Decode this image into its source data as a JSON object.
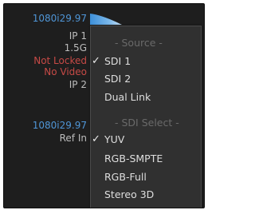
{
  "status_panel": {
    "format_top": "1080i29.97",
    "input_1": "IP 1",
    "bitrate": "1.5G",
    "lock_status": "Not Locked",
    "video_status": "No Video",
    "input_2": "IP 2",
    "format_bottom": "1080i29.97",
    "ref_label": "Ref In"
  },
  "dropdown": {
    "source_header": "- Source -",
    "source_options": [
      {
        "label": "SDI 1",
        "checked": true
      },
      {
        "label": "SDI 2",
        "checked": false
      },
      {
        "label": "Dual Link",
        "checked": false
      }
    ],
    "sdi_select_header": "- SDI Select -",
    "sdi_options": [
      {
        "label": "YUV",
        "checked": true
      },
      {
        "label": "RGB-SMPTE",
        "checked": false
      },
      {
        "label": "RGB-Full",
        "checked": false
      },
      {
        "label": "Stereo 3D",
        "checked": false
      }
    ],
    "check_glyph": "✓"
  },
  "colors": {
    "accent_blue": "#4f95d6",
    "error_red": "#c64a46",
    "menu_bg": "#303030",
    "panel_bg": "#1e1e1e"
  }
}
